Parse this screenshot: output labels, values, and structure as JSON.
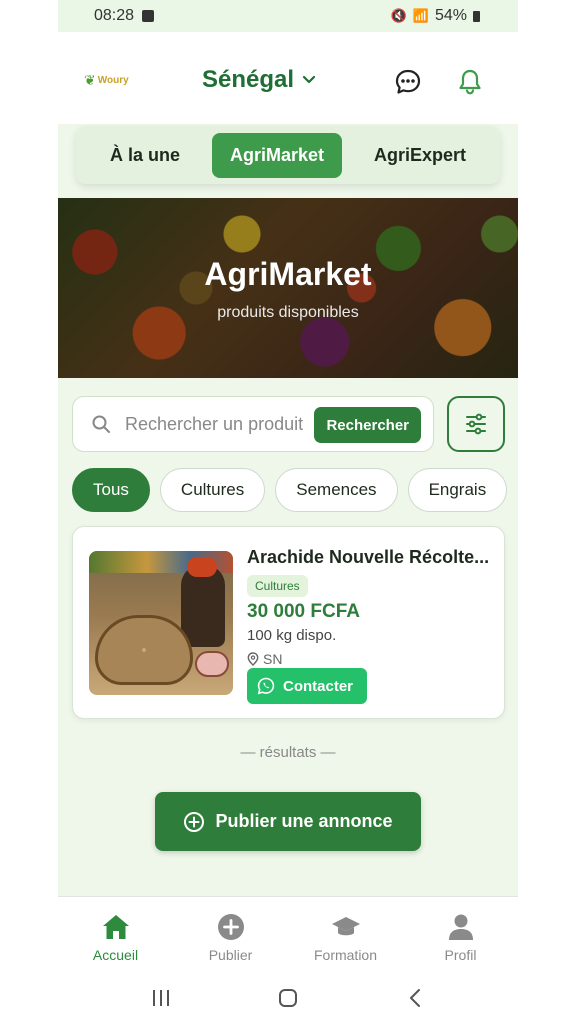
{
  "status_bar": {
    "time": "08:28",
    "battery": "54%"
  },
  "header": {
    "logo_text": "Woury",
    "country": "Sénégal"
  },
  "tabs": [
    {
      "label": "À la une",
      "active": false
    },
    {
      "label": "AgriMarket",
      "active": true
    },
    {
      "label": "AgriExpert",
      "active": false
    }
  ],
  "hero": {
    "title": "AgriMarket",
    "subtitle": "produits disponibles"
  },
  "search": {
    "placeholder": "Rechercher un produit",
    "button_label": "Rechercher"
  },
  "filters": [
    {
      "label": "Tous",
      "active": true
    },
    {
      "label": "Cultures",
      "active": false
    },
    {
      "label": "Semences",
      "active": false
    },
    {
      "label": "Engrais",
      "active": false
    }
  ],
  "product": {
    "title": "Arachide Nouvelle Récolte...",
    "category": "Cultures",
    "price": "30 000 FCFA",
    "quantity": "100 kg dispo.",
    "location": "SN",
    "contact_label": "Contacter"
  },
  "results_label": "— résultats —",
  "publish_button": "Publier une annonce",
  "bottom_nav": [
    {
      "label": "Accueil",
      "icon": "home-icon",
      "active": true
    },
    {
      "label": "Publier",
      "icon": "plus-circle-icon",
      "active": false
    },
    {
      "label": "Formation",
      "icon": "graduation-cap-icon",
      "active": false
    },
    {
      "label": "Profil",
      "icon": "person-icon",
      "active": false
    }
  ],
  "colors": {
    "primary": "#2e7d3a",
    "accent_tab": "#3e9b4b",
    "whatsapp": "#25c16a",
    "background": "#eef7ea"
  }
}
